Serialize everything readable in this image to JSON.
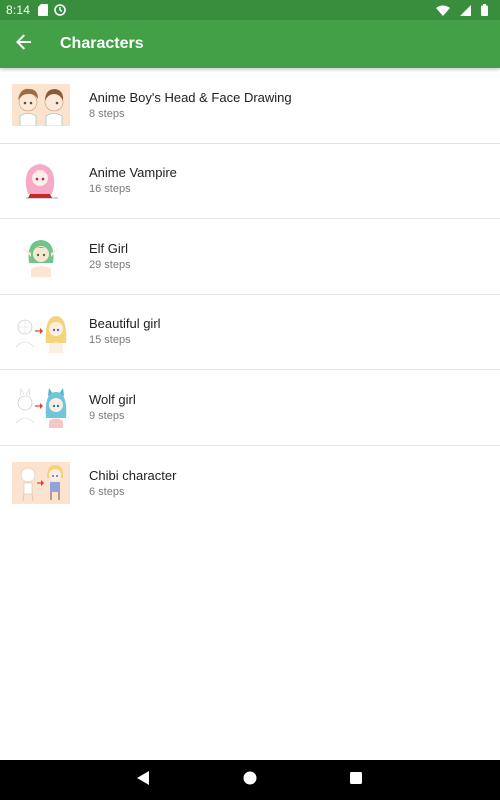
{
  "status_bar": {
    "time": "8:14",
    "left_icons": [
      "sd-card-icon",
      "sync-icon"
    ],
    "right_icons": [
      "wifi-icon",
      "cell-signal-icon",
      "battery-icon"
    ]
  },
  "app_bar": {
    "title": "Characters",
    "back_icon": "arrow-back-icon",
    "background": "#43a047",
    "status_background": "#388e3c"
  },
  "items": [
    {
      "title": "Anime Boy's Head & Face Drawing",
      "subtitle": "8 steps",
      "thumbnail": "anime-boy-thumbnail"
    },
    {
      "title": "Anime Vampire",
      "subtitle": "16 steps",
      "thumbnail": "anime-vampire-thumbnail"
    },
    {
      "title": "Elf Girl",
      "subtitle": "29 steps",
      "thumbnail": "elf-girl-thumbnail"
    },
    {
      "title": "Beautiful girl",
      "subtitle": "15 steps",
      "thumbnail": "beautiful-girl-thumbnail"
    },
    {
      "title": "Wolf girl",
      "subtitle": "9 steps",
      "thumbnail": "wolf-girl-thumbnail"
    },
    {
      "title": "Chibi character",
      "subtitle": "6 steps",
      "thumbnail": "chibi-character-thumbnail"
    }
  ],
  "nav_bar": {
    "buttons": [
      "back-triangle-icon",
      "home-circle-icon",
      "recents-square-icon"
    ]
  }
}
